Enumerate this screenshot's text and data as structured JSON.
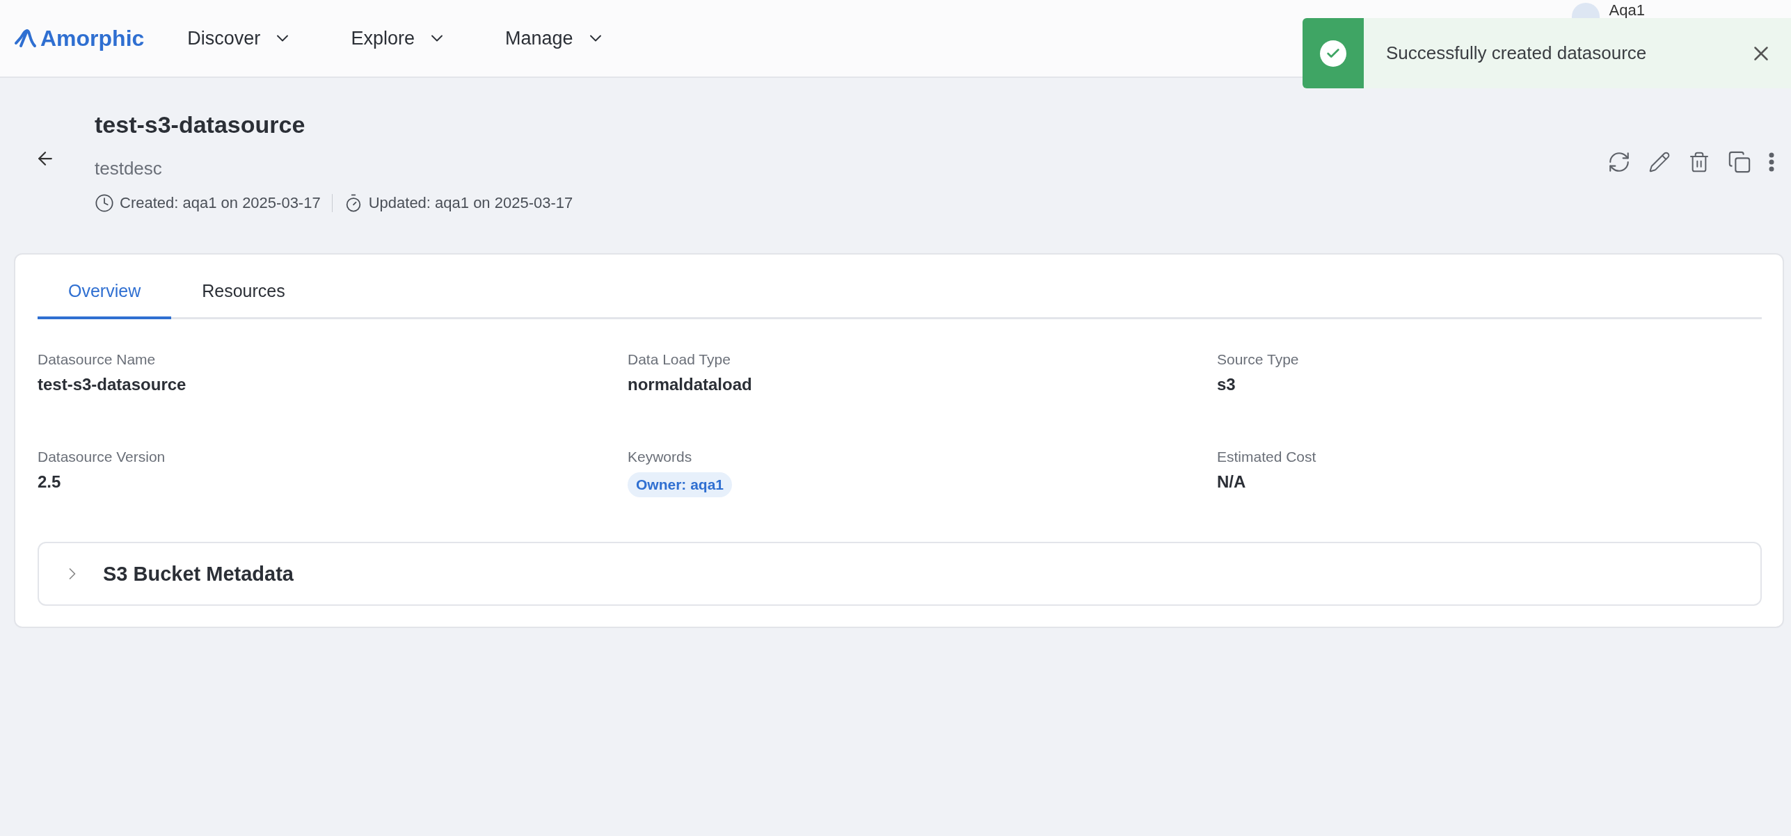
{
  "header": {
    "logo": "Amorphic",
    "nav": [
      {
        "label": "Discover"
      },
      {
        "label": "Explore"
      },
      {
        "label": "Manage"
      }
    ],
    "user": {
      "name": "Aqa1"
    }
  },
  "toast": {
    "kind": "success",
    "message": "Successfully created datasource"
  },
  "page": {
    "title": "test-s3-datasource",
    "description": "testdesc",
    "created": "Created: aqa1 on 2025-03-17",
    "updated": "Updated: aqa1 on 2025-03-17"
  },
  "tabs": [
    {
      "label": "Overview",
      "selected": true
    },
    {
      "label": "Resources",
      "selected": false
    }
  ],
  "fields": [
    {
      "label": "Datasource Name",
      "value": "test-s3-datasource"
    },
    {
      "label": "Data Load Type",
      "value": "normaldataload"
    },
    {
      "label": "Source Type",
      "value": "s3"
    },
    {
      "label": "Datasource Version",
      "value": "2.5"
    },
    {
      "label": "Keywords",
      "tags": [
        "Owner: aqa1"
      ]
    },
    {
      "label": "Estimated Cost",
      "value": "N/A"
    }
  ],
  "accordion": {
    "title": "S3 Bucket Metadata",
    "expanded": false
  }
}
